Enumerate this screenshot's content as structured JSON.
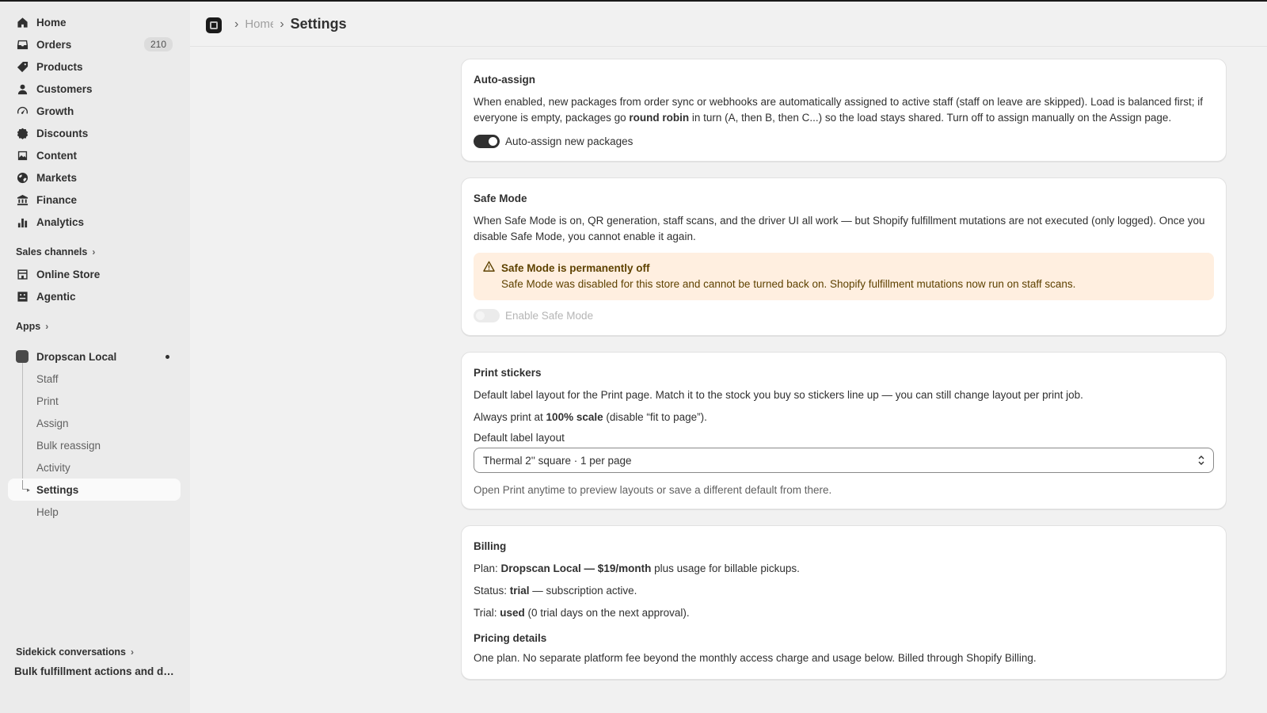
{
  "sidebar": {
    "nav": [
      {
        "label": "Home",
        "icon": "home-icon"
      },
      {
        "label": "Orders",
        "icon": "inbox-icon",
        "badge": "210"
      },
      {
        "label": "Products",
        "icon": "tag-icon"
      },
      {
        "label": "Customers",
        "icon": "person-icon"
      },
      {
        "label": "Growth",
        "icon": "gauge-icon"
      },
      {
        "label": "Discounts",
        "icon": "discount-icon"
      },
      {
        "label": "Content",
        "icon": "content-icon"
      },
      {
        "label": "Markets",
        "icon": "globe-icon"
      },
      {
        "label": "Finance",
        "icon": "bank-icon"
      },
      {
        "label": "Analytics",
        "icon": "bar-chart-icon"
      }
    ],
    "sales_channels_label": "Sales channels",
    "channels": [
      {
        "label": "Online Store",
        "icon": "store-icon"
      },
      {
        "label": "Agentic",
        "icon": "agent-icon"
      }
    ],
    "apps_label": "Apps",
    "app": {
      "label": "Dropscan Local",
      "sub_items": [
        "Staff",
        "Print",
        "Assign",
        "Bulk reassign",
        "Activity",
        "Settings",
        "Help"
      ],
      "active": "Settings"
    },
    "sidekick_label": "Sidekick conversations",
    "sidekick_item": "Bulk fulfillment actions and delivery"
  },
  "header": {
    "breadcrumb_home": "Home",
    "title": "Settings"
  },
  "cards": {
    "auto_assign": {
      "title": "Auto-assign",
      "desc_1": "When enabled, new packages from order sync or webhooks are automatically assigned to active staff (staff on leave are skipped). Load is balanced first; if everyone is empty, packages go ",
      "desc_bold": "round robin",
      "desc_2": " in turn (A, then B, then C...) so the load stays shared. Turn off to assign manually on the Assign page.",
      "toggle_label": "Auto-assign new packages",
      "toggle_on": true
    },
    "safe_mode": {
      "title": "Safe Mode",
      "desc": "When Safe Mode is on, QR generation, staff scans, and the driver UI all work — but Shopify fulfillment mutations are not executed (only logged). Once you disable Safe Mode, you cannot enable it again.",
      "banner_title": "Safe Mode is permanently off",
      "banner_text": "Safe Mode was disabled for this store and cannot be turned back on. Shopify fulfillment mutations now run on staff scans.",
      "toggle_label": "Enable Safe Mode",
      "toggle_on": false
    },
    "print": {
      "title": "Print stickers",
      "desc": "Default label layout for the Print page. Match it to the stock you buy so stickers line up — you can still change layout per print job.",
      "scale_1": "Always print at ",
      "scale_bold": "100% scale",
      "scale_2": " (disable “fit to page”).",
      "field_label": "Default label layout",
      "selected": "Thermal 2'' square · 1 per page",
      "help": "Open Print anytime to preview layouts or save a different default from there."
    },
    "billing": {
      "title": "Billing",
      "plan_prefix": "Plan: ",
      "plan_bold": "Dropscan Local — $19/month",
      "plan_suffix": " plus usage for billable pickups.",
      "status_prefix": "Status: ",
      "status_bold": "trial",
      "status_suffix": " — subscription active.",
      "trial_prefix": "Trial: ",
      "trial_bold": "used",
      "trial_suffix": " (0 trial days on the next approval).",
      "pricing_title": "Pricing details",
      "pricing_text": "One plan. No separate platform fee beyond the monthly access charge and usage below. Billed through Shopify Billing."
    }
  },
  "colors": {
    "sidebar_bg": "#ebebeb",
    "main_bg": "#f1f1f1",
    "card_bg": "#ffffff",
    "banner_bg": "#ffefe0",
    "banner_text": "#5e4200",
    "toggle_on": "#303030"
  }
}
